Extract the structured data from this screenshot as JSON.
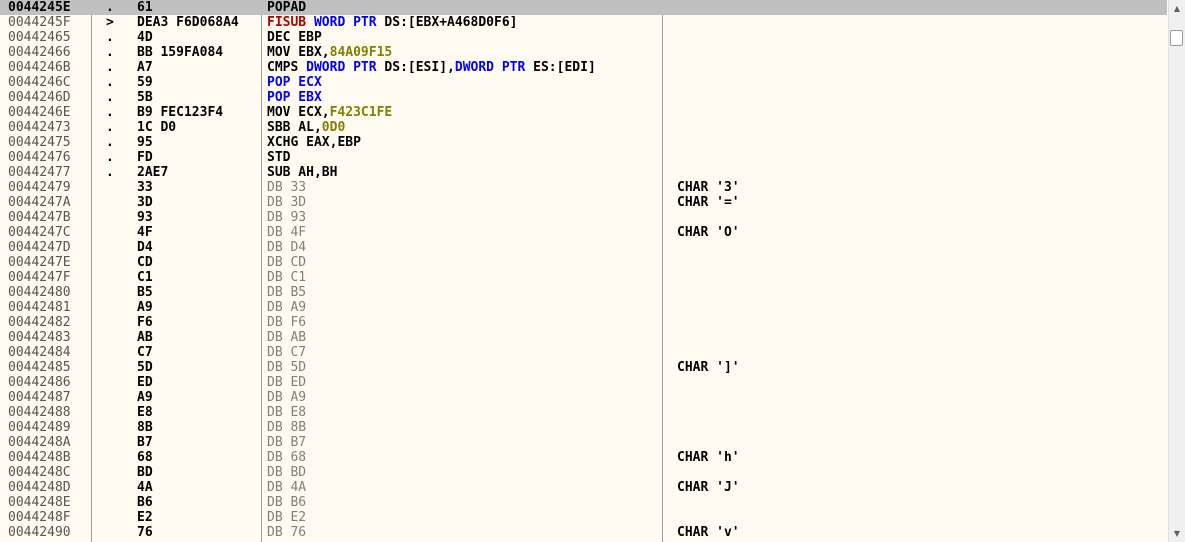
{
  "disassembly": {
    "rows": [
      {
        "addr": "0044245E",
        "mark": ".",
        "hex": "61",
        "dis": [
          {
            "t": "POPAD"
          }
        ],
        "comment": "",
        "selected": true
      },
      {
        "addr": "0044245F",
        "mark": ">",
        "hex": "DEA3 F6D068A4",
        "dis": [
          {
            "t": "FISUB",
            "c": "red"
          },
          {
            "t": " "
          },
          {
            "t": "WORD PTR",
            "c": "blue"
          },
          {
            "t": " DS:[EBX+A468D0F6]"
          }
        ],
        "comment": ""
      },
      {
        "addr": "00442465",
        "mark": ".",
        "hex": "4D",
        "dis": [
          {
            "t": "DEC EBP"
          }
        ],
        "comment": ""
      },
      {
        "addr": "00442466",
        "mark": ".",
        "hex": "BB 159FA084",
        "dis": [
          {
            "t": "MOV EBX,"
          },
          {
            "t": "84A09F15",
            "c": "num"
          }
        ],
        "comment": ""
      },
      {
        "addr": "0044246B",
        "mark": ".",
        "hex": "A7",
        "dis": [
          {
            "t": "CMPS "
          },
          {
            "t": "DWORD PTR",
            "c": "blue"
          },
          {
            "t": " DS:[ESI],"
          },
          {
            "t": "DWORD PTR",
            "c": "blue"
          },
          {
            "t": " ES:[EDI]"
          }
        ],
        "comment": ""
      },
      {
        "addr": "0044246C",
        "mark": ".",
        "hex": "59",
        "dis": [
          {
            "t": "POP ECX",
            "c": "blue"
          }
        ],
        "comment": ""
      },
      {
        "addr": "0044246D",
        "mark": ".",
        "hex": "5B",
        "dis": [
          {
            "t": "POP EBX",
            "c": "blue"
          }
        ],
        "comment": ""
      },
      {
        "addr": "0044246E",
        "mark": ".",
        "hex": "B9 FEC123F4",
        "dis": [
          {
            "t": "MOV ECX,"
          },
          {
            "t": "F423C1FE",
            "c": "num"
          }
        ],
        "comment": ""
      },
      {
        "addr": "00442473",
        "mark": ".",
        "hex": "1C D0",
        "dis": [
          {
            "t": "SBB AL,"
          },
          {
            "t": "0D0",
            "c": "num"
          }
        ],
        "comment": ""
      },
      {
        "addr": "00442475",
        "mark": ".",
        "hex": "95",
        "dis": [
          {
            "t": "XCHG EAX,EBP"
          }
        ],
        "comment": ""
      },
      {
        "addr": "00442476",
        "mark": ".",
        "hex": "FD",
        "dis": [
          {
            "t": "STD"
          }
        ],
        "comment": ""
      },
      {
        "addr": "00442477",
        "mark": ".",
        "hex": "2AE7",
        "dis": [
          {
            "t": "SUB AH,BH"
          }
        ],
        "comment": ""
      },
      {
        "addr": "00442479",
        "mark": "",
        "hex": "33",
        "dis": [
          {
            "t": "DB 33"
          }
        ],
        "comment": "CHAR '3'",
        "data": true
      },
      {
        "addr": "0044247A",
        "mark": "",
        "hex": "3D",
        "dis": [
          {
            "t": "DB 3D"
          }
        ],
        "comment": "CHAR '='",
        "data": true
      },
      {
        "addr": "0044247B",
        "mark": "",
        "hex": "93",
        "dis": [
          {
            "t": "DB 93"
          }
        ],
        "comment": "",
        "data": true
      },
      {
        "addr": "0044247C",
        "mark": "",
        "hex": "4F",
        "dis": [
          {
            "t": "DB 4F"
          }
        ],
        "comment": "CHAR 'O'",
        "data": true
      },
      {
        "addr": "0044247D",
        "mark": "",
        "hex": "D4",
        "dis": [
          {
            "t": "DB D4"
          }
        ],
        "comment": "",
        "data": true
      },
      {
        "addr": "0044247E",
        "mark": "",
        "hex": "CD",
        "dis": [
          {
            "t": "DB CD"
          }
        ],
        "comment": "",
        "data": true
      },
      {
        "addr": "0044247F",
        "mark": "",
        "hex": "C1",
        "dis": [
          {
            "t": "DB C1"
          }
        ],
        "comment": "",
        "data": true
      },
      {
        "addr": "00442480",
        "mark": "",
        "hex": "B5",
        "dis": [
          {
            "t": "DB B5"
          }
        ],
        "comment": "",
        "data": true
      },
      {
        "addr": "00442481",
        "mark": "",
        "hex": "A9",
        "dis": [
          {
            "t": "DB A9"
          }
        ],
        "comment": "",
        "data": true
      },
      {
        "addr": "00442482",
        "mark": "",
        "hex": "F6",
        "dis": [
          {
            "t": "DB F6"
          }
        ],
        "comment": "",
        "data": true
      },
      {
        "addr": "00442483",
        "mark": "",
        "hex": "AB",
        "dis": [
          {
            "t": "DB AB"
          }
        ],
        "comment": "",
        "data": true
      },
      {
        "addr": "00442484",
        "mark": "",
        "hex": "C7",
        "dis": [
          {
            "t": "DB C7"
          }
        ],
        "comment": "",
        "data": true
      },
      {
        "addr": "00442485",
        "mark": "",
        "hex": "5D",
        "dis": [
          {
            "t": "DB 5D"
          }
        ],
        "comment": "CHAR ']'",
        "data": true
      },
      {
        "addr": "00442486",
        "mark": "",
        "hex": "ED",
        "dis": [
          {
            "t": "DB ED"
          }
        ],
        "comment": "",
        "data": true
      },
      {
        "addr": "00442487",
        "mark": "",
        "hex": "A9",
        "dis": [
          {
            "t": "DB A9"
          }
        ],
        "comment": "",
        "data": true
      },
      {
        "addr": "00442488",
        "mark": "",
        "hex": "E8",
        "dis": [
          {
            "t": "DB E8"
          }
        ],
        "comment": "",
        "data": true
      },
      {
        "addr": "00442489",
        "mark": "",
        "hex": "8B",
        "dis": [
          {
            "t": "DB 8B"
          }
        ],
        "comment": "",
        "data": true
      },
      {
        "addr": "0044248A",
        "mark": "",
        "hex": "B7",
        "dis": [
          {
            "t": "DB B7"
          }
        ],
        "comment": "",
        "data": true
      },
      {
        "addr": "0044248B",
        "mark": "",
        "hex": "68",
        "dis": [
          {
            "t": "DB 68"
          }
        ],
        "comment": "CHAR 'h'",
        "data": true
      },
      {
        "addr": "0044248C",
        "mark": "",
        "hex": "BD",
        "dis": [
          {
            "t": "DB BD"
          }
        ],
        "comment": "",
        "data": true
      },
      {
        "addr": "0044248D",
        "mark": "",
        "hex": "4A",
        "dis": [
          {
            "t": "DB 4A"
          }
        ],
        "comment": "CHAR 'J'",
        "data": true
      },
      {
        "addr": "0044248E",
        "mark": "",
        "hex": "B6",
        "dis": [
          {
            "t": "DB B6"
          }
        ],
        "comment": "",
        "data": true
      },
      {
        "addr": "0044248F",
        "mark": "",
        "hex": "E2",
        "dis": [
          {
            "t": "DB E2"
          }
        ],
        "comment": "",
        "data": true
      },
      {
        "addr": "00442490",
        "mark": "",
        "hex": "76",
        "dis": [
          {
            "t": "DB 76"
          }
        ],
        "comment": "CHAR 'v'",
        "data": true
      }
    ]
  },
  "scrollbar": {
    "up_icon": "triangle-up-icon",
    "down_icon": "triangle-down-icon",
    "up_glyph": "▲",
    "down_glyph": "▼"
  },
  "colors": {
    "background": "#fffbf0",
    "selected_row": "#c0c0c0",
    "keyword_blue": "#0000ff",
    "keyword_red": "#b00000",
    "immediate_olive": "#808000",
    "data_gray": "#808080"
  }
}
